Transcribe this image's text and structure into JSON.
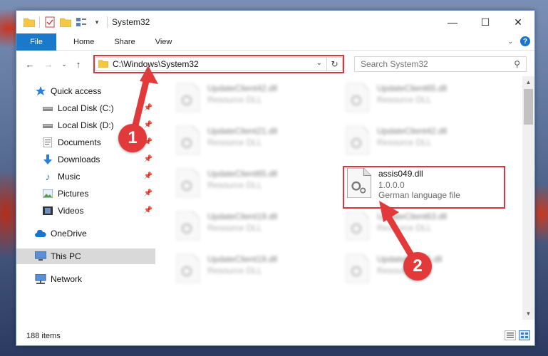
{
  "window": {
    "title": "System32",
    "controls": {
      "minimize": "—",
      "maximize": "☐",
      "close": "✕"
    }
  },
  "ribbon": {
    "tabs": [
      {
        "label": "File"
      },
      {
        "label": "Home"
      },
      {
        "label": "Share"
      },
      {
        "label": "View"
      }
    ],
    "help": "?"
  },
  "navigation": {
    "address": "C:\\Windows\\System32",
    "search_placeholder": "Search System32"
  },
  "sidebar": {
    "items": [
      {
        "label": "Quick access",
        "icon": "star-icon"
      },
      {
        "label": "Local Disk (C:)",
        "icon": "drive-icon",
        "pinned": true
      },
      {
        "label": "Local Disk (D:)",
        "icon": "drive-icon",
        "pinned": true
      },
      {
        "label": "Documents",
        "icon": "document-icon",
        "pinned": true
      },
      {
        "label": "Downloads",
        "icon": "download-icon",
        "pinned": true
      },
      {
        "label": "Music",
        "icon": "music-icon",
        "pinned": true
      },
      {
        "label": "Pictures",
        "icon": "pictures-icon",
        "pinned": true
      },
      {
        "label": "Videos",
        "icon": "video-icon",
        "pinned": true
      },
      {
        "label": "OneDrive",
        "icon": "cloud-icon"
      },
      {
        "label": "This PC",
        "icon": "computer-icon",
        "selected": true
      },
      {
        "label": "Network",
        "icon": "network-icon"
      }
    ]
  },
  "files": [
    {
      "name": "UpdateClient42.dll",
      "type": "Resource DLL"
    },
    {
      "name": "UpdateClient65.dll",
      "type": "Resource DLL"
    },
    {
      "name": "UpdateClient21.dll",
      "type": "Resource DLL"
    },
    {
      "name": "UpdateClient42.dll",
      "type": "Resource DLL"
    },
    {
      "name": "UpdateClient65.dll",
      "type": "Resource DLL"
    },
    {
      "name": "assis049.dll",
      "version": "1.0.0.0",
      "type": "German language file",
      "highlighted": true
    },
    {
      "name": "UpdateClient19.dll",
      "type": "Resource DLL"
    },
    {
      "name": "UpdateClient63.dll",
      "type": "Resource DLL"
    },
    {
      "name": "UpdateClient19.dll",
      "type": "Resource DLL"
    },
    {
      "name": "UpdateClient5.dll",
      "type": "Resource DLL"
    }
  ],
  "status": {
    "item_count": "188 items"
  },
  "annotations": {
    "step1": "1",
    "step2": "2",
    "color": "#e23a3a"
  }
}
